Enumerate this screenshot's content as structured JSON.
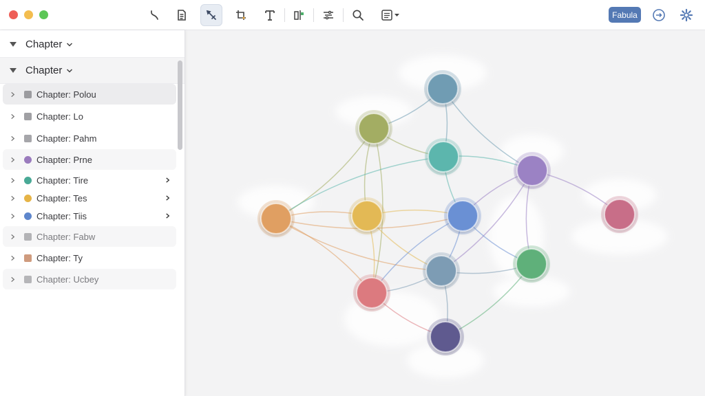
{
  "window": {
    "traffic_lights": [
      "close",
      "minimize",
      "zoom"
    ]
  },
  "toolbar": {
    "brand_label": "Fabula",
    "tools": [
      {
        "name": "curve-tool-icon"
      },
      {
        "name": "document-icon"
      },
      {
        "name": "pen-tool-icon",
        "active": true
      },
      {
        "name": "crop-tool-icon"
      },
      {
        "name": "text-tool-icon"
      },
      {
        "name": "align-tool-icon"
      },
      {
        "name": "filter-tool-icon"
      },
      {
        "name": "search-icon"
      },
      {
        "name": "view-menu-icon"
      }
    ],
    "right_icons": [
      "timeline-icon",
      "settings-gear-icon"
    ]
  },
  "sidebar": {
    "headers": [
      {
        "label": "Chapter"
      },
      {
        "label": "Chapter"
      }
    ],
    "items": [
      {
        "label": "Chapter: Polou",
        "color": "#9b9b9f",
        "shape": "square"
      },
      {
        "label": "Chapter: Lo",
        "color": "#a0a0a4",
        "shape": "square"
      },
      {
        "label": "Chapter: Pahm",
        "color": "#a6a6aa",
        "shape": "square"
      },
      {
        "label": "Chapter: Prne",
        "color": "#9a7bbd",
        "shape": "round"
      },
      {
        "label": "Chapter: Tire",
        "color": "#49a996",
        "shape": "round"
      },
      {
        "label": "Chapter: Tes",
        "color": "#e6b447",
        "shape": "round"
      },
      {
        "label": "Chapter: Tiis",
        "color": "#5e86cc",
        "shape": "round"
      },
      {
        "label": "Chapter: Fabw",
        "color": "#b3b3b6",
        "shape": "square"
      },
      {
        "label": "Chapter: Ty",
        "color": "#cf9b7e",
        "shape": "square"
      },
      {
        "label": "Chapter: Ucbey",
        "color": "#b5b5b8",
        "shape": "square"
      }
    ]
  },
  "graph": {
    "nodes": [
      {
        "id": "slate",
        "color": "#6f9cb3"
      },
      {
        "id": "olive",
        "color": "#a3ad63"
      },
      {
        "id": "teal",
        "color": "#5bb6ad"
      },
      {
        "id": "violet",
        "color": "#9b82c4"
      },
      {
        "id": "orange",
        "color": "#e09f62"
      },
      {
        "id": "gold",
        "color": "#e3b955"
      },
      {
        "id": "blue",
        "color": "#6b90d4"
      },
      {
        "id": "rose",
        "color": "#c86e88"
      },
      {
        "id": "steel",
        "color": "#7d9cb4"
      },
      {
        "id": "green",
        "color": "#5fb07a"
      },
      {
        "id": "coral",
        "color": "#dc7a7f"
      },
      {
        "id": "indigo",
        "color": "#5e5a8f"
      }
    ],
    "edges": [
      [
        "slate",
        "teal"
      ],
      [
        "slate",
        "violet"
      ],
      [
        "slate",
        "olive"
      ],
      [
        "olive",
        "teal"
      ],
      [
        "olive",
        "orange"
      ],
      [
        "olive",
        "gold"
      ],
      [
        "olive",
        "coral"
      ],
      [
        "teal",
        "orange"
      ],
      [
        "teal",
        "violet"
      ],
      [
        "teal",
        "blue"
      ],
      [
        "orange",
        "gold"
      ],
      [
        "orange",
        "blue"
      ],
      [
        "orange",
        "coral"
      ],
      [
        "orange",
        "steel"
      ],
      [
        "gold",
        "coral"
      ],
      [
        "gold",
        "steel"
      ],
      [
        "gold",
        "blue"
      ],
      [
        "violet",
        "blue"
      ],
      [
        "violet",
        "rose"
      ],
      [
        "violet",
        "green"
      ],
      [
        "violet",
        "steel"
      ],
      [
        "blue",
        "coral"
      ],
      [
        "blue",
        "steel"
      ],
      [
        "blue",
        "green"
      ],
      [
        "steel",
        "coral"
      ],
      [
        "steel",
        "green"
      ],
      [
        "steel",
        "indigo"
      ],
      [
        "coral",
        "indigo"
      ],
      [
        "green",
        "indigo"
      ]
    ]
  }
}
